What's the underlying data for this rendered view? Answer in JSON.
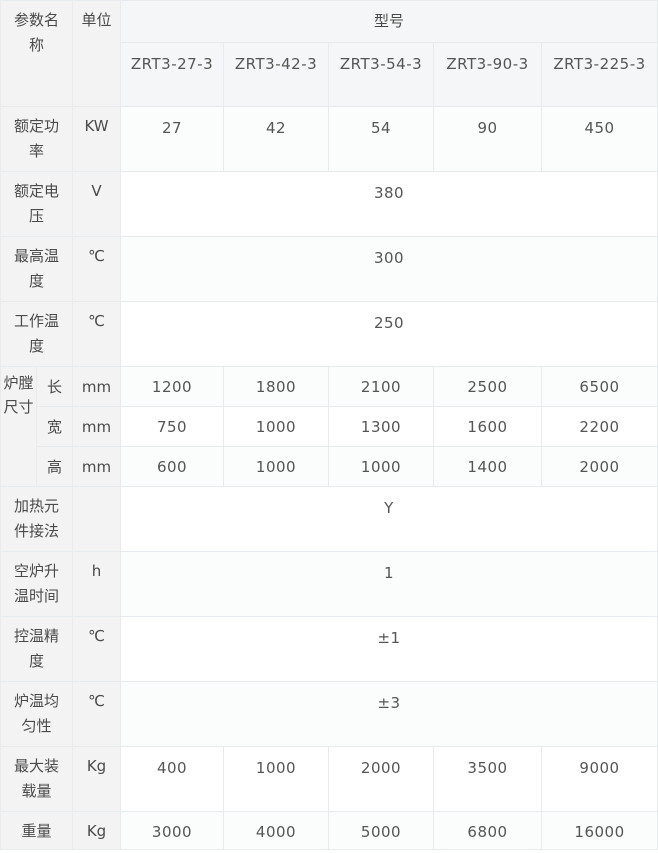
{
  "table": {
    "header": {
      "param_name": "参数名称",
      "unit": "单位",
      "model_group": "型号",
      "models": [
        "ZRT3-27-3",
        "ZRT3-42-3",
        "ZRT3-54-3",
        "ZRT3-90-3",
        "ZRT3-225-3"
      ]
    },
    "rows": {
      "rated_power": {
        "label": "额定功率",
        "unit": "KW",
        "values": [
          "27",
          "42",
          "54",
          "90",
          "450"
        ]
      },
      "rated_voltage": {
        "label": "额定电压",
        "unit": "V",
        "value": "380"
      },
      "max_temp": {
        "label": "最高温度",
        "unit": "℃",
        "value": "300"
      },
      "work_temp": {
        "label": "工作温度",
        "unit": "℃",
        "value": "250"
      },
      "chamber_size": {
        "label": "炉膛尺寸",
        "dims": [
          {
            "label": "长",
            "unit": "mm",
            "values": [
              "1200",
              "1800",
              "2100",
              "2500",
              "6500"
            ]
          },
          {
            "label": "宽",
            "unit": "mm",
            "values": [
              "750",
              "1000",
              "1300",
              "1600",
              "2200"
            ]
          },
          {
            "label": "高",
            "unit": "mm",
            "values": [
              "600",
              "1000",
              "1000",
              "1400",
              "2000"
            ]
          }
        ]
      },
      "heating_connection": {
        "label": "加热元件接法",
        "unit": "",
        "value": "Y"
      },
      "heatup_time": {
        "label": "空炉升温时间",
        "unit": "h",
        "value": "1"
      },
      "temp_accuracy": {
        "label": "控温精度",
        "unit": "℃",
        "value": "±1"
      },
      "temp_uniformity": {
        "label": "炉温均匀性",
        "unit": "℃",
        "value": "±3"
      },
      "max_load": {
        "label": "最大装载量",
        "unit": "Kg",
        "values": [
          "400",
          "1000",
          "2000",
          "3500",
          "9000"
        ]
      },
      "weight": {
        "label": "重量",
        "unit": "Kg",
        "values": [
          "3000",
          "4000",
          "5000",
          "6800",
          "16000"
        ]
      }
    }
  }
}
